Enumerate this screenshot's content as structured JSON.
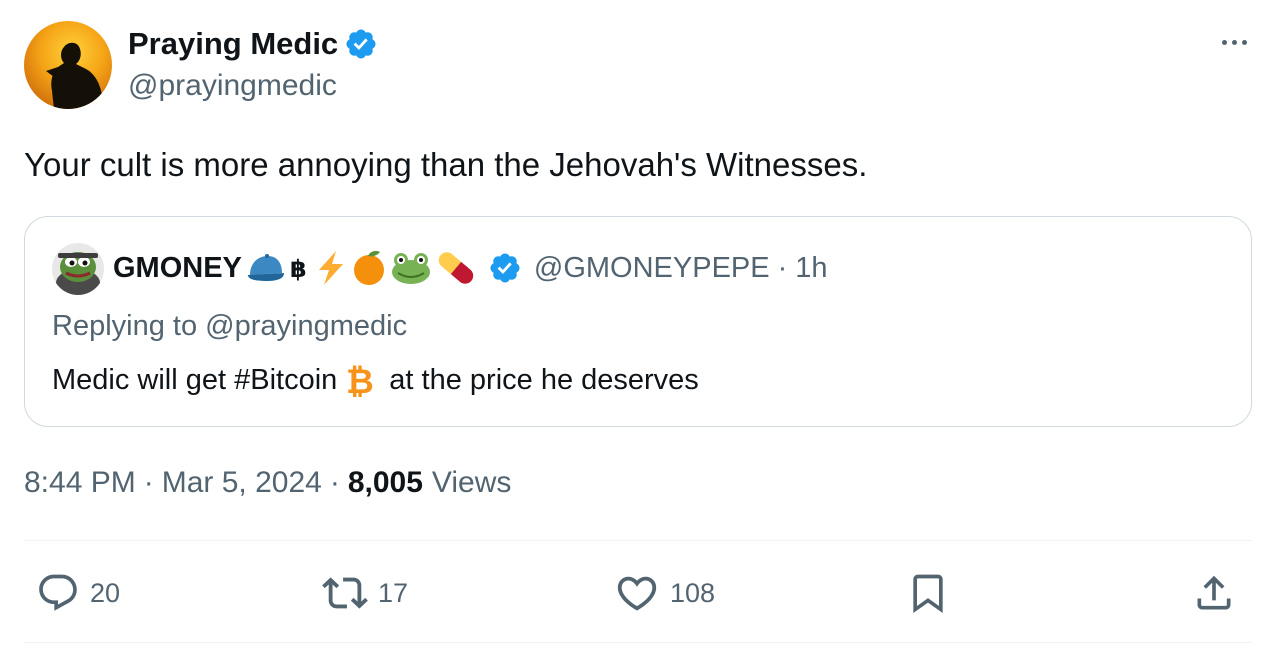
{
  "author": {
    "name": "Praying Medic",
    "handle": "@prayingmedic",
    "verified": true
  },
  "tweet": {
    "text": "Your cult is more annoying than the Jehovah's Witnesses."
  },
  "quote": {
    "name": "GMONEY",
    "emojis": [
      "cap-emoji",
      "bitcoin-symbol",
      "lightning-emoji",
      "orange-emoji",
      "frog-emoji",
      "pill-emoji"
    ],
    "handle": "@GMONEYPEPE",
    "separator": "·",
    "time": "1h",
    "reply_prefix": "Replying to ",
    "reply_handle": "@prayingmedic",
    "body_before": "Medic will get #Bitcoin",
    "body_after": "at the price he deserves"
  },
  "meta": {
    "time": "8:44 PM",
    "sep1": "·",
    "date": "Mar 5, 2024",
    "sep2": "·",
    "views_count": "8,005",
    "views_label": "Views"
  },
  "actions": {
    "replies": "20",
    "reposts": "17",
    "likes": "108"
  },
  "colors": {
    "text": "#0f1419",
    "secondary": "#536471",
    "verified": "#1d9bf0",
    "border": "#cfd9de",
    "bitcoin": "#f7931a"
  }
}
